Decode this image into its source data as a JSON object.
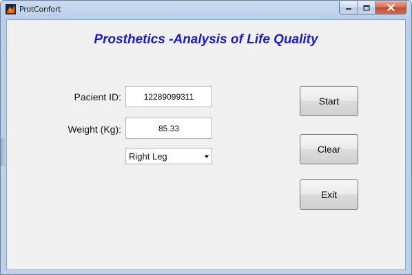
{
  "window": {
    "title": "ProtConfort",
    "app_icon": "matlab-icon",
    "controls": {
      "minimize_icon": "minimize-icon",
      "maximize_icon": "maximize-icon",
      "close_icon": "close-icon"
    }
  },
  "main": {
    "heading": "Prosthetics -Analysis of Life Quality",
    "heading_color": "#1a1ad4",
    "form": {
      "pacient_id_label": "Pacient ID:",
      "pacient_id_value": "12289099311",
      "weight_label": "Weight (Kg):",
      "weight_value": "85.33",
      "leg_select_value": "Right Leg"
    },
    "buttons": {
      "start": "Start",
      "clear": "Clear",
      "exit": "Exit"
    }
  }
}
